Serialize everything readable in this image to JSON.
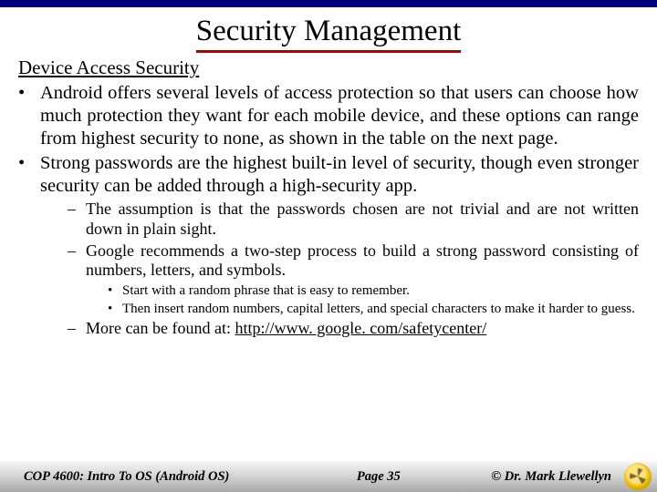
{
  "title": "Security Management",
  "subhead": "Device Access Security",
  "bullets": {
    "b1": "Android offers several levels of access protection so that users can choose how much protection they want for each mobile device, and these options can range from highest security to none, as shown in the table on the next page.",
    "b2": "Strong passwords are the highest built-in level of security, though even stronger security can be added through a high-security app."
  },
  "sub": {
    "s1": "The assumption is that the passwords chosen are not trivial and are not written down in plain sight.",
    "s2": "Google recommends a two-step process to build a strong password consisting of numbers, letters, and symbols.",
    "s3_prefix": "More can be found at: ",
    "s3_link": "http://www. google. com/safetycenter/"
  },
  "subsub": {
    "a": "Start with a random phrase that is easy to remember.",
    "b": "Then insert random numbers, capital letters, and special characters to make it harder to guess."
  },
  "footer": {
    "course": "COP 4600: Intro To OS  (Android OS)",
    "page": "Page 35",
    "author": "© Dr. Mark Llewellyn"
  }
}
